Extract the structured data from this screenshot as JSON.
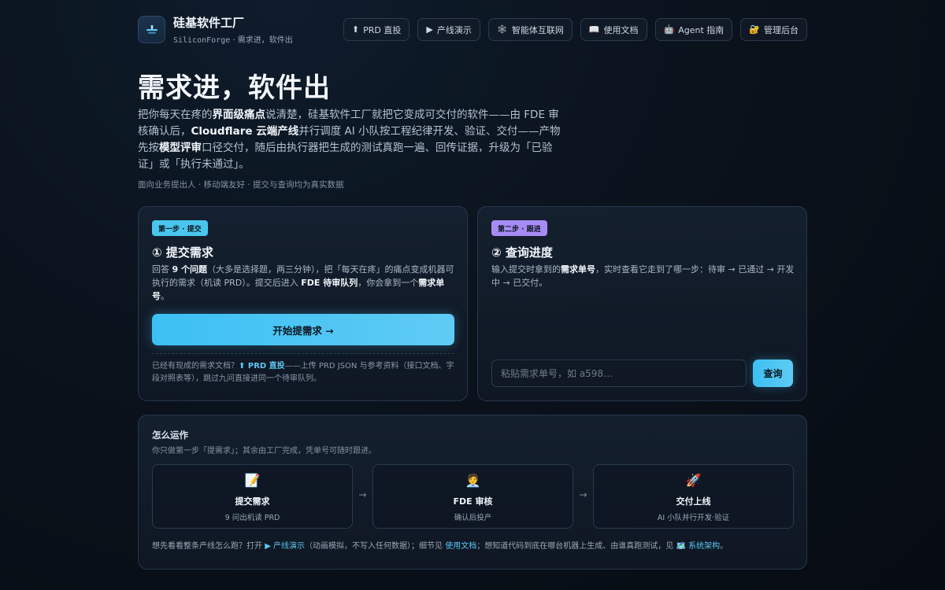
{
  "header": {
    "brand_title": "硅基软件工厂",
    "brand_sub_en": "SiliconForge",
    "brand_sub_sep": " · ",
    "brand_sub_cn": "需求进，软件出",
    "nav": [
      {
        "icon": "⬆",
        "icon_name": "upload-icon",
        "label": "PRD 直投"
      },
      {
        "icon": "▶",
        "icon_name": "play-icon",
        "label": "产线演示"
      },
      {
        "icon": "🕸",
        "icon_name": "web-icon",
        "label": "智能体互联网"
      },
      {
        "icon": "📖",
        "icon_name": "book-icon",
        "label": "使用文档"
      },
      {
        "icon": "🤖",
        "icon_name": "robot-icon",
        "label": "Agent 指南"
      },
      {
        "icon": "🔐",
        "icon_name": "lock-icon",
        "label": "管理后台"
      }
    ]
  },
  "hero": {
    "title": "需求进，软件出",
    "desc_1": "把你每天在疼的",
    "desc_b1": "界面级痛点",
    "desc_2": "说清楚，硅基软件工厂就把它变成可交付的软件——由 FDE 审核确认后，",
    "desc_b2": "Cloudflare 云端产线",
    "desc_3": "并行调度 AI 小队按工程纪律开发、验证、交付——产物先按",
    "desc_b3": "模型评审",
    "desc_4": "口径交付，随后由执行器把生成的测试真跑一遍、回传证据，升级为「已验证」或「执行未通过」。",
    "meta": "面向业务提出人 · 移动端友好 · 提交与查询均为真实数据"
  },
  "submit_card": {
    "pill": "第一步 · 提交",
    "title": "① 提交需求",
    "text_1": "回答 ",
    "text_b1": "9 个问题",
    "text_2": "（大多是选择题，两三分钟），把「每天在疼」的痛点变成机器可执行的需求（机读 PRD）。提交后进入 ",
    "text_b2": "FDE 待审队列",
    "text_3": "，你会拿到一个",
    "text_b3": "需求单号",
    "text_4": "。",
    "button": "开始提需求 →",
    "foot_1": "已经有现成的需求文档？",
    "foot_link": "⬆ PRD 直投",
    "foot_2": "——上传 PRD JSON 与参考资料（接口文档、字段对照表等），跳过九问直接进同一个待审队列。"
  },
  "query_card": {
    "pill": "第二步 · 跟进",
    "title": "② 查询进度",
    "text_1": "输入提交时拿到的",
    "text_b1": "需求单号",
    "text_2": "，实时查看它走到了哪一步：待审 → 已通过 → 开发中 → 已交付。",
    "input_placeholder": "粘贴需求单号，如 a598…",
    "input_value": "",
    "button": "查询"
  },
  "how": {
    "title": "怎么运作",
    "sub": "你只做第一步「提需求」；其余由工厂完成，凭单号可随时跟进。",
    "steps": [
      {
        "emoji": "📝",
        "icon_name": "memo-icon",
        "title": "提交需求",
        "sub": "9 问出机读 PRD"
      },
      {
        "emoji": "🧑‍💼",
        "icon_name": "reviewer-icon",
        "title": "FDE 审核",
        "sub": "确认后投产"
      },
      {
        "emoji": "🚀",
        "icon_name": "rocket-icon",
        "title": "交付上线",
        "sub": "AI 小队并行开发·验证"
      }
    ],
    "arrow": "→",
    "foot_1": "想先看看整条产线怎么跑？打开 ",
    "foot_link1": "▶ 产线演示",
    "foot_2": "（动画模拟，不写入任何数据）；细节见 ",
    "foot_link2": "使用文档",
    "foot_3": "；想知道代码到底在哪台机器上生成、由谁真跑测试，见 ",
    "foot_link3": "🗺️ 系统架构",
    "foot_4": "。"
  },
  "colors": {
    "accent": "#49c6ee",
    "accent_purple": "#a78bf4",
    "background": "#0a121c"
  }
}
